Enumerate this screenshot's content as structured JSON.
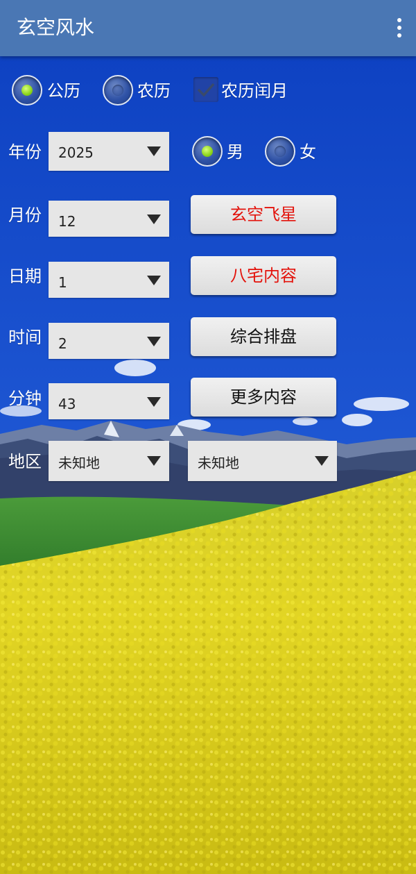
{
  "app_bar": {
    "title": "玄空风水",
    "overflow_icon": "more-vert-icon"
  },
  "calendar_type": {
    "options": [
      {
        "label": "公历",
        "selected": true
      },
      {
        "label": "农历",
        "selected": false
      }
    ],
    "leap_month": {
      "label": "农历闰月",
      "checked": true
    }
  },
  "form": {
    "year": {
      "label": "年份",
      "value": "2025"
    },
    "month": {
      "label": "月份",
      "value": "12"
    },
    "day": {
      "label": "日期",
      "value": "1"
    },
    "hour": {
      "label": "时间",
      "value": "2"
    },
    "minute": {
      "label": "分钟",
      "value": "43"
    },
    "region": {
      "label": "地区",
      "value1": "未知地",
      "value2": "未知地"
    }
  },
  "gender": {
    "options": [
      {
        "label": "男",
        "selected": true
      },
      {
        "label": "女",
        "selected": false
      }
    ]
  },
  "buttons": {
    "xuankong": "玄空飞星",
    "bazhai": "八宅内容",
    "zonghe": "综合排盘",
    "more": "更多内容"
  },
  "colors": {
    "app_bar": "#4a77b4",
    "radio_selected": "#8bd41a",
    "button_red_text": "#e3120b"
  }
}
